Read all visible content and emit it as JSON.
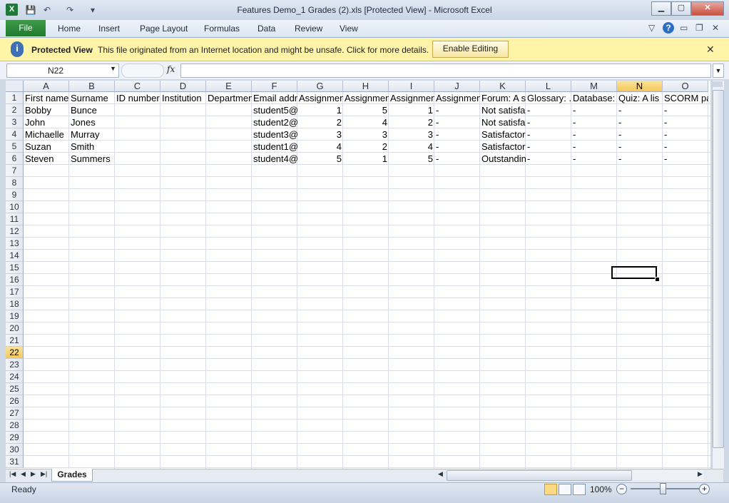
{
  "window": {
    "title": "Features Demo_1 Grades (2).xls  [Protected View]  -  Microsoft Excel",
    "app_icon": "X",
    "minimize": "▁",
    "maximize": "▢",
    "close": "✕"
  },
  "qat": {
    "save": "💾",
    "undo": "↶",
    "redo": "↷",
    "customize": "▾"
  },
  "ribbon": {
    "file": "File",
    "tabs": [
      "Home",
      "Insert",
      "Page Layout",
      "Formulas",
      "Data",
      "Review",
      "View"
    ],
    "help": "?"
  },
  "protected_view": {
    "icon": "i",
    "title": "Protected View",
    "message": "This file originated from an Internet location and might be unsafe. Click for more details.",
    "enable_button": "Enable Editing",
    "close": "✕"
  },
  "formula_bar": {
    "name_box": "N22",
    "fx": "fx",
    "formula": ""
  },
  "columns": [
    "A",
    "B",
    "C",
    "D",
    "E",
    "F",
    "G",
    "H",
    "I",
    "J",
    "K",
    "L",
    "M",
    "N",
    "O"
  ],
  "selected_column": "N",
  "selected_row": "22",
  "rows": [
    "1",
    "2",
    "3",
    "4",
    "5",
    "6",
    "7",
    "8",
    "9",
    "10",
    "11",
    "12",
    "13",
    "14",
    "15",
    "16",
    "17",
    "18",
    "19",
    "20",
    "21",
    "22",
    "23",
    "24",
    "25",
    "26",
    "27",
    "28",
    "29",
    "30",
    "31"
  ],
  "cells": {
    "header": [
      "First name",
      "Surname",
      "ID number",
      "Institution",
      "Departmen",
      "Email addr",
      "Assignmen",
      "Assignmen",
      "Assignmen",
      "Assignmen",
      "Forum: A s",
      "Glossary: .",
      "Database:",
      "Quiz: A lis",
      "SCORM pa"
    ],
    "r2": [
      "Bobby",
      "Bunce",
      "",
      "",
      "",
      "student5@",
      "1",
      "5",
      "1",
      "-",
      "Not satisfa",
      "-",
      "-",
      "-",
      "-"
    ],
    "r3": [
      "John",
      "Jones",
      "",
      "",
      "",
      "student2@",
      "2",
      "4",
      "2",
      "-",
      "Not satisfa",
      "-",
      "-",
      "-",
      "-"
    ],
    "r4": [
      "Michaelle",
      "Murray",
      "",
      "",
      "",
      "student3@",
      "3",
      "3",
      "3",
      "-",
      "Satisfactor",
      "-",
      "-",
      "-",
      "-"
    ],
    "r5": [
      "Suzan",
      "Smith",
      "",
      "",
      "",
      "student1@",
      "4",
      "2",
      "4",
      "-",
      "Satisfactor",
      "-",
      "-",
      "-",
      "-"
    ],
    "r6": [
      "Steven",
      "Summers",
      "",
      "",
      "",
      "student4@",
      "5",
      "1",
      "5",
      "-",
      "Outstandin",
      "-",
      "-",
      "-",
      "-"
    ]
  },
  "sheet_tab": "Grades",
  "status": {
    "ready": "Ready",
    "zoom": "100%",
    "zoom_out": "−",
    "zoom_in": "+"
  }
}
